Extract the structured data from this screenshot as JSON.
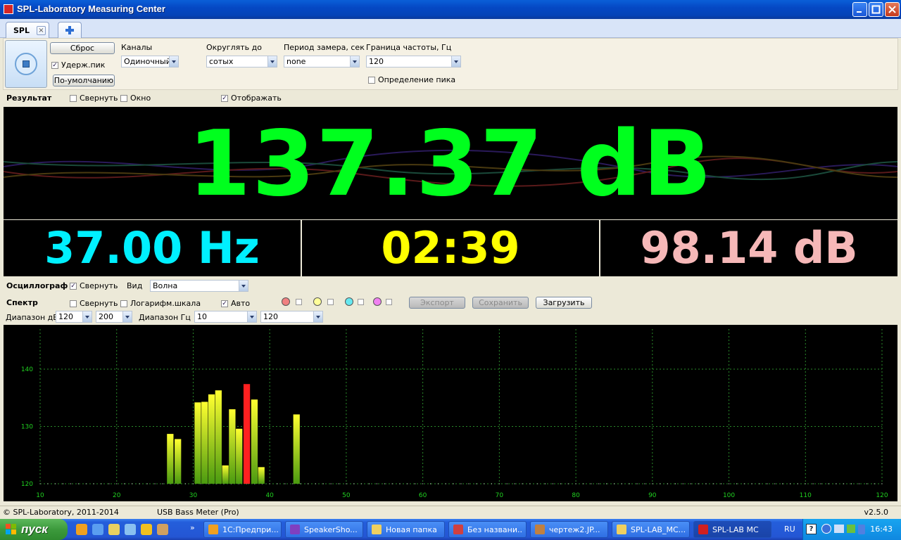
{
  "window": {
    "title": "SPL-Laboratory Measuring Center"
  },
  "tabs": [
    {
      "label": "SPL"
    }
  ],
  "settings": {
    "reset_label": "Сброс",
    "hold_peak_label": "Удерж.пик",
    "default_label": "По-умолчанию",
    "channels": {
      "label": "Каналы",
      "value": "Одиночный"
    },
    "round": {
      "label": "Округлять до",
      "value": "сотых"
    },
    "period": {
      "label": "Период замера, сек",
      "value": "none"
    },
    "freq_limit": {
      "label": "Граница частоты, Гц",
      "value": "120"
    },
    "peak_detect_label": "Определение пика"
  },
  "result": {
    "title": "Результат",
    "collapse_label": "Свернуть",
    "window_label": "Окно",
    "display_label": "Отображать",
    "main_value": "137.37 dB",
    "frequency": "37.00 Hz",
    "time": "02:39",
    "secondary_level": "98.14 dB"
  },
  "oscillograph": {
    "title": "Осциллограф",
    "collapse_label": "Свернуть",
    "view_label": "Вид",
    "view_value": "Волна"
  },
  "spectrum": {
    "title": "Спектр",
    "collapse_label": "Свернуть",
    "log_label": "Логарифм.шкала",
    "auto_label": "Авто",
    "export_label": "Экспорт",
    "save_label": "Сохранить",
    "load_label": "Загрузить",
    "db_range_label": "Диапазон дБ",
    "db_min": "120",
    "db_max": "200",
    "hz_range_label": "Диапазон Гц",
    "hz_min": "10",
    "hz_max": "120",
    "swatch_colors": [
      "#f08080",
      "#ffff99",
      "#66e8f0",
      "#f080f0"
    ]
  },
  "chart_data": {
    "type": "bar",
    "xlim": [
      10,
      120
    ],
    "ylim": [
      120,
      147
    ],
    "x_ticks": [
      10,
      20,
      30,
      40,
      50,
      60,
      70,
      80,
      90,
      100,
      110,
      120
    ],
    "y_ticks": [
      120,
      130,
      140
    ],
    "grid": true,
    "bars": [
      {
        "x": 27,
        "y": 128.7
      },
      {
        "x": 28,
        "y": 127.8
      },
      {
        "x": 30.6,
        "y": 134.2
      },
      {
        "x": 31.5,
        "y": 134.3
      },
      {
        "x": 32.4,
        "y": 135.6
      },
      {
        "x": 33.3,
        "y": 136.3
      },
      {
        "x": 34.2,
        "y": 123.2
      },
      {
        "x": 35.1,
        "y": 133.0
      },
      {
        "x": 36,
        "y": 129.6
      },
      {
        "x": 37,
        "y": 137.4,
        "peak": true
      },
      {
        "x": 38,
        "y": 134.7
      },
      {
        "x": 38.9,
        "y": 122.9
      },
      {
        "x": 43.5,
        "y": 132.1
      }
    ],
    "colors": {
      "bar_top": "#ffff30",
      "bar_bottom": "#4a9a10",
      "peak": "#ff2020",
      "grid": "#2a8a2a",
      "axis_text": "#20d020"
    }
  },
  "statusbar": {
    "copyright": "© SPL-Laboratory, 2011-2014",
    "device": "USB Bass Meter (Pro)",
    "version": "v2.5.0"
  },
  "taskbar": {
    "start_label": "пуск",
    "tasks": [
      {
        "label": "1С:Предпри...",
        "color": "#f0a020"
      },
      {
        "label": "SpeakerSho...",
        "color": "#8040c0"
      },
      {
        "label": "Новая папка",
        "color": "#f0d060"
      },
      {
        "label": "Без названи...",
        "color": "#d04040"
      },
      {
        "label": "чертеж2.JP...",
        "color": "#c08040"
      },
      {
        "label": "SPL-LAB_MC...",
        "color": "#f0d060"
      },
      {
        "label": "SPL-LAB MC",
        "color": "#d02020"
      }
    ],
    "lang": "RU",
    "clock": "16:43"
  }
}
